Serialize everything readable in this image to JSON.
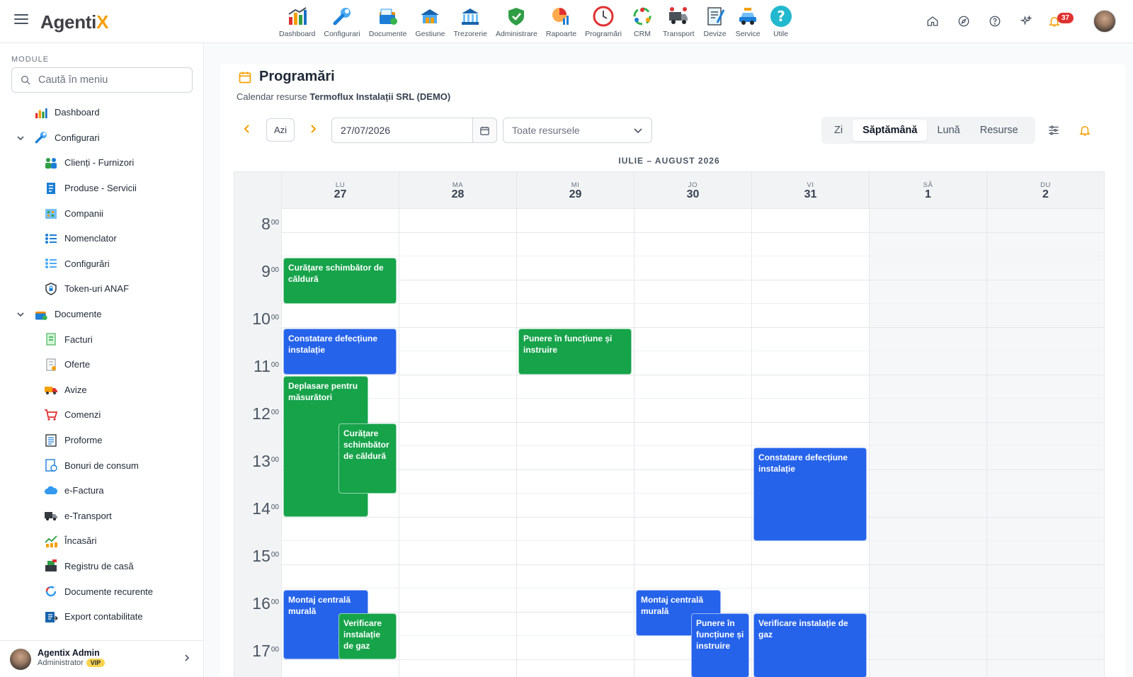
{
  "app": {
    "logo_main": "Agenti",
    "logo_x": "X"
  },
  "modules": [
    {
      "label": "Dashboard",
      "icon": "dashboard-icon"
    },
    {
      "label": "Configurari",
      "icon": "wrench-icon"
    },
    {
      "label": "Documente",
      "icon": "documents-icon"
    },
    {
      "label": "Gestiune",
      "icon": "warehouse-icon"
    },
    {
      "label": "Trezorerie",
      "icon": "bank-icon"
    },
    {
      "label": "Administrare",
      "icon": "shield-icon"
    },
    {
      "label": "Rapoarte",
      "icon": "reports-icon"
    },
    {
      "label": "Programări",
      "icon": "clock-icon"
    },
    {
      "label": "CRM",
      "icon": "crm-icon"
    },
    {
      "label": "Transport",
      "icon": "truck-icon"
    },
    {
      "label": "Devize",
      "icon": "estimate-icon"
    },
    {
      "label": "Service",
      "icon": "car-service-icon"
    },
    {
      "label": "Utile",
      "icon": "help-circle-icon"
    }
  ],
  "notifications": {
    "count": "37"
  },
  "sidebar": {
    "section_label": "MODULE",
    "search_placeholder": "Caută în meniu",
    "items": [
      {
        "label": "Dashboard",
        "level": 0,
        "icon": "dashboard-icon"
      },
      {
        "label": "Configurari",
        "level": 0,
        "expandable": true,
        "icon": "wrench-icon"
      },
      {
        "label": "Clienți - Furnizori",
        "level": 1,
        "icon": "people-icon"
      },
      {
        "label": "Produse - Servicii",
        "level": 1,
        "icon": "products-icon"
      },
      {
        "label": "Companii",
        "level": 1,
        "icon": "company-icon"
      },
      {
        "label": "Nomenclator",
        "level": 1,
        "icon": "list-icon"
      },
      {
        "label": "Configurări",
        "level": 1,
        "icon": "settings-list-icon"
      },
      {
        "label": "Token-uri ANAF",
        "level": 1,
        "icon": "lock-shield-icon"
      },
      {
        "label": "Documente",
        "level": 0,
        "expandable": true,
        "icon": "documents-icon"
      },
      {
        "label": "Facturi",
        "level": 1,
        "icon": "invoice-icon"
      },
      {
        "label": "Oferte",
        "level": 1,
        "icon": "offer-icon"
      },
      {
        "label": "Avize",
        "level": 1,
        "icon": "delivery-truck-icon"
      },
      {
        "label": "Comenzi",
        "level": 1,
        "icon": "cart-icon"
      },
      {
        "label": "Proforme",
        "level": 1,
        "icon": "proforma-icon"
      },
      {
        "label": "Bonuri de consum",
        "level": 1,
        "icon": "receipt-icon"
      },
      {
        "label": "e-Factura",
        "level": 1,
        "icon": "cloud-icon"
      },
      {
        "label": "e-Transport",
        "level": 1,
        "icon": "transport-icon"
      },
      {
        "label": "Încasări",
        "level": 1,
        "icon": "chart-coins-icon"
      },
      {
        "label": "Registru de casă",
        "level": 1,
        "icon": "cash-register-icon"
      },
      {
        "label": "Documente recurente",
        "level": 1,
        "icon": "recurring-icon"
      },
      {
        "label": "Export contabilitate",
        "level": 1,
        "icon": "export-icon"
      }
    ]
  },
  "user": {
    "name": "Agentix Admin",
    "role": "Administrator",
    "badge": "VIP"
  },
  "page": {
    "title": "Programări",
    "subtitle_prefix": "Calendar resurse",
    "subtitle_company": "Termoflux Instalații SRL (DEMO)"
  },
  "toolbar": {
    "today_label": "Azi",
    "date_value": "27/07/2026",
    "resource_select": "Toate resursele",
    "views": [
      "Zi",
      "Săptămână",
      "Lună",
      "Resurse"
    ],
    "active_view": "Săptămână"
  },
  "calendar": {
    "range_label": "IULIE – AUGUST 2026",
    "days": [
      {
        "name": "LU",
        "num": "27"
      },
      {
        "name": "MA",
        "num": "28"
      },
      {
        "name": "MI",
        "num": "29"
      },
      {
        "name": "JO",
        "num": "30"
      },
      {
        "name": "VI",
        "num": "31"
      },
      {
        "name": "SÂ",
        "num": "1"
      },
      {
        "name": "DU",
        "num": "2"
      }
    ],
    "hours": [
      {
        "h": "8",
        "m": "00"
      },
      {
        "h": "9",
        "m": "00"
      },
      {
        "h": "10",
        "m": "00"
      },
      {
        "h": "11",
        "m": "00"
      },
      {
        "h": "12",
        "m": "00"
      },
      {
        "h": "13",
        "m": "00"
      },
      {
        "h": "14",
        "m": "00"
      },
      {
        "h": "15",
        "m": "00"
      },
      {
        "h": "16",
        "m": "00"
      },
      {
        "h": "17",
        "m": "00"
      }
    ],
    "events": [
      {
        "title": "Curățare schimbător de căldură",
        "day": 0,
        "start": "08:30",
        "end": "09:30",
        "color": "#16a34a"
      },
      {
        "title": "Constatare defecțiune instalație",
        "day": 0,
        "start": "10:00",
        "end": "11:00",
        "color": "#2563eb"
      },
      {
        "title": "Deplasare pentru măsurători",
        "day": 0,
        "start": "11:00",
        "end": "14:00",
        "color": "#16a34a"
      },
      {
        "title": "Curățare schimbător de căldură",
        "day": 0,
        "start": "12:00",
        "end": "13:30",
        "color": "#16a34a"
      },
      {
        "title": "Montaj centrală murală",
        "day": 0,
        "start": "15:30",
        "end": "17:00",
        "color": "#2563eb"
      },
      {
        "title": "Verificare instalație de gaz",
        "day": 0,
        "start": "16:00",
        "end": "17:00",
        "color": "#16a34a"
      },
      {
        "title": "Punere în funcțiune și instruire",
        "day": 2,
        "start": "10:00",
        "end": "11:00",
        "color": "#16a34a"
      },
      {
        "title": "Montaj centrală murală",
        "day": 3,
        "start": "15:30",
        "end": "16:30",
        "color": "#2563eb"
      },
      {
        "title": "Punere în funcțiune și instruire",
        "day": 3,
        "start": "16:00",
        "end": "18:00",
        "color": "#2563eb"
      },
      {
        "title": "Constatare defecțiune instalație",
        "day": 4,
        "start": "12:30",
        "end": "14:30",
        "color": "#2563eb"
      },
      {
        "title": "Verificare instalație de gaz",
        "day": 4,
        "start": "16:00",
        "end": "18:00",
        "color": "#2563eb"
      }
    ]
  }
}
